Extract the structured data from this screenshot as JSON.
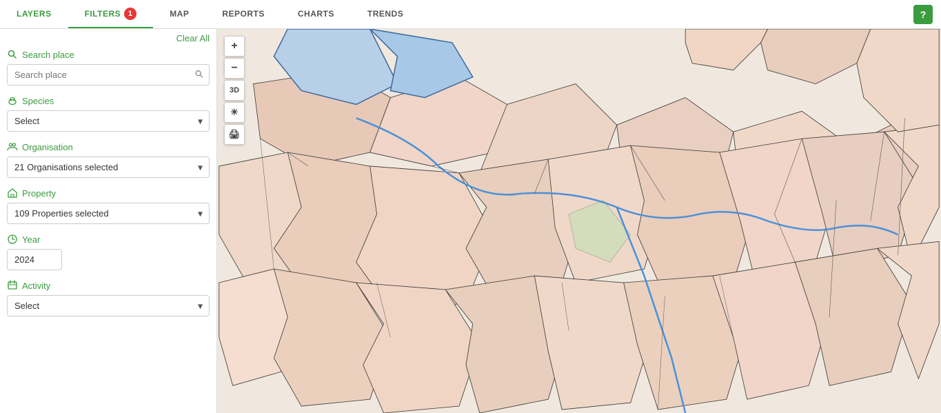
{
  "nav": {
    "tabs": [
      {
        "label": "LAYERS",
        "active": false
      },
      {
        "label": "FILTERS",
        "active": true,
        "badge": "1"
      },
      {
        "label": "MAP",
        "active": false
      },
      {
        "label": "REPORTS",
        "active": false
      },
      {
        "label": "CHARTS",
        "active": false
      },
      {
        "label": "TRENDS",
        "active": false
      }
    ],
    "help_label": "?"
  },
  "sidebar": {
    "clear_all_label": "Clear All",
    "search_place": {
      "label": "Search place",
      "placeholder": "Search place"
    },
    "species": {
      "label": "Species",
      "select_placeholder": "Select",
      "value": ""
    },
    "organisation": {
      "label": "Organisation",
      "value": "21 Organisations selected"
    },
    "property": {
      "label": "Property",
      "value": "109 Properties selected"
    },
    "year": {
      "label": "Year",
      "value": "2024"
    },
    "activity": {
      "label": "Activity",
      "select_placeholder": "Select",
      "value": ""
    }
  },
  "map_controls": {
    "zoom_in": "+",
    "zoom_out": "−",
    "three_d": "3D",
    "light": "☀",
    "print": "🖨"
  }
}
